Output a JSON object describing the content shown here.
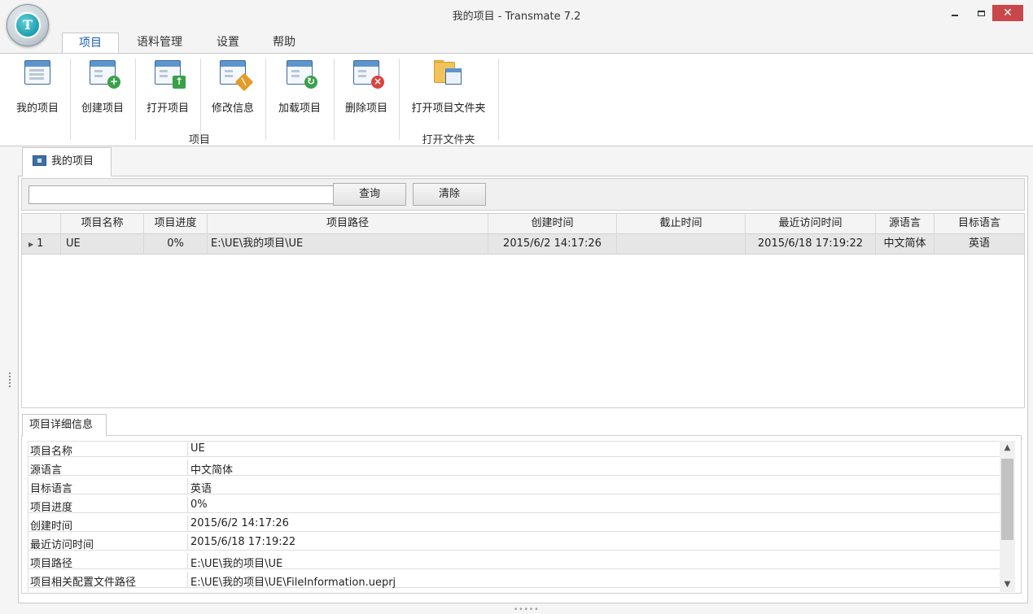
{
  "window": {
    "title": "我的项目 - Transmate 7.2",
    "logo_letter": "T",
    "minimize_icon": "minimize-icon",
    "maximize_icon": "maximize-icon",
    "close_symbol": "✕"
  },
  "ribbon": {
    "tabs": [
      {
        "label": "项目",
        "active": true
      },
      {
        "label": "语料管理",
        "active": false
      },
      {
        "label": "设置",
        "active": false
      },
      {
        "label": "帮助",
        "active": false
      }
    ],
    "buttons": {
      "my_projects": "我的项目",
      "create_project": "创建项目",
      "open_project": "打开项目",
      "edit_info": "修改信息",
      "load_project": "加载项目",
      "delete_project": "删除项目",
      "open_project_folder": "打开项目文件夹"
    },
    "groups": {
      "project": "项目",
      "open_folder": "打开文件夹"
    }
  },
  "doc_tab": {
    "label": "我的项目"
  },
  "search": {
    "value": "",
    "query_label": "查询",
    "clear_label": "清除"
  },
  "grid": {
    "columns": [
      "",
      "项目名称",
      "项目进度",
      "项目路径",
      "创建时间",
      "截止时间",
      "最近访问时间",
      "源语言",
      "目标语言"
    ],
    "rows": [
      {
        "index": "1",
        "name": "UE",
        "progress": "0%",
        "path": "E:\\UE\\我的项目\\UE",
        "created": "2015/6/2 14:17:26",
        "deadline": "",
        "last_access": "2015/6/18 17:19:22",
        "source_lang": "中文简体",
        "target_lang": "英语"
      }
    ]
  },
  "details": {
    "tab_label": "项目详细信息",
    "rows": [
      {
        "key": "项目名称",
        "value": "UE"
      },
      {
        "key": "源语言",
        "value": "中文简体"
      },
      {
        "key": "目标语言",
        "value": "英语"
      },
      {
        "key": "项目进度",
        "value": "0%"
      },
      {
        "key": "创建时间",
        "value": "2015/6/2 14:17:26"
      },
      {
        "key": "最近访问时间",
        "value": "2015/6/18 17:19:22"
      },
      {
        "key": "项目路径",
        "value": "E:\\UE\\我的项目\\UE"
      },
      {
        "key": "项目相关配置文件路径",
        "value": "E:\\UE\\我的项目\\UE\\FileInformation.ueprj"
      }
    ]
  },
  "colors": {
    "accent": "#1a5fb4",
    "close_button": "#c9474b",
    "selected_row": "#e6e6e6"
  }
}
